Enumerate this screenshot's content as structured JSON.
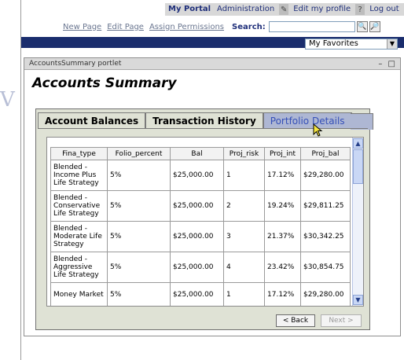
{
  "portal_bar": {
    "my_portal": "My Portal",
    "administration": "Administration",
    "edit_profile": "Edit my profile",
    "logout": "Log out",
    "help_glyph": "?"
  },
  "links": {
    "new_page": "New Page",
    "edit_page": "Edit Page",
    "assign_permissions": "Assign Permissions",
    "search_label": "Search:"
  },
  "favorites": {
    "selected": "My Favorites"
  },
  "portlet": {
    "title": "AccountsSummary portlet",
    "heading": "Accounts Summary",
    "tabs": [
      "Account Balances",
      "Transaction History",
      "Portfolio Details"
    ],
    "active_tab": "Portfolio Details"
  },
  "table": {
    "headers": [
      "Fina_type",
      "Folio_percent",
      "Bal",
      "Proj_risk",
      "Proj_int",
      "Proj_bal"
    ],
    "rows": [
      [
        "Blended - Income Plus Life Strategy",
        "5%",
        "$25,000.00",
        "1",
        "17.12%",
        "$29,280.00"
      ],
      [
        "Blended - Conservative Life Strategy",
        "5%",
        "$25,000.00",
        "2",
        "19.24%",
        "$29,811.25"
      ],
      [
        "Blended - Moderate Life Strategy",
        "5%",
        "$25,000.00",
        "3",
        "21.37%",
        "$30,342.25"
      ],
      [
        "Blended - Aggressive Life Strategy",
        "5%",
        "$25,000.00",
        "4",
        "23.42%",
        "$30,854.75"
      ],
      [
        "Money Market",
        "5%",
        "$25,000.00",
        "1",
        "17.12%",
        "$29,280.00"
      ]
    ]
  },
  "buttons": {
    "back": "< Back",
    "next": "Next >"
  },
  "colors": {
    "navy": "#1a2d6d",
    "active_tab": "#aeb7d3",
    "panel": "#dfe2d5"
  }
}
